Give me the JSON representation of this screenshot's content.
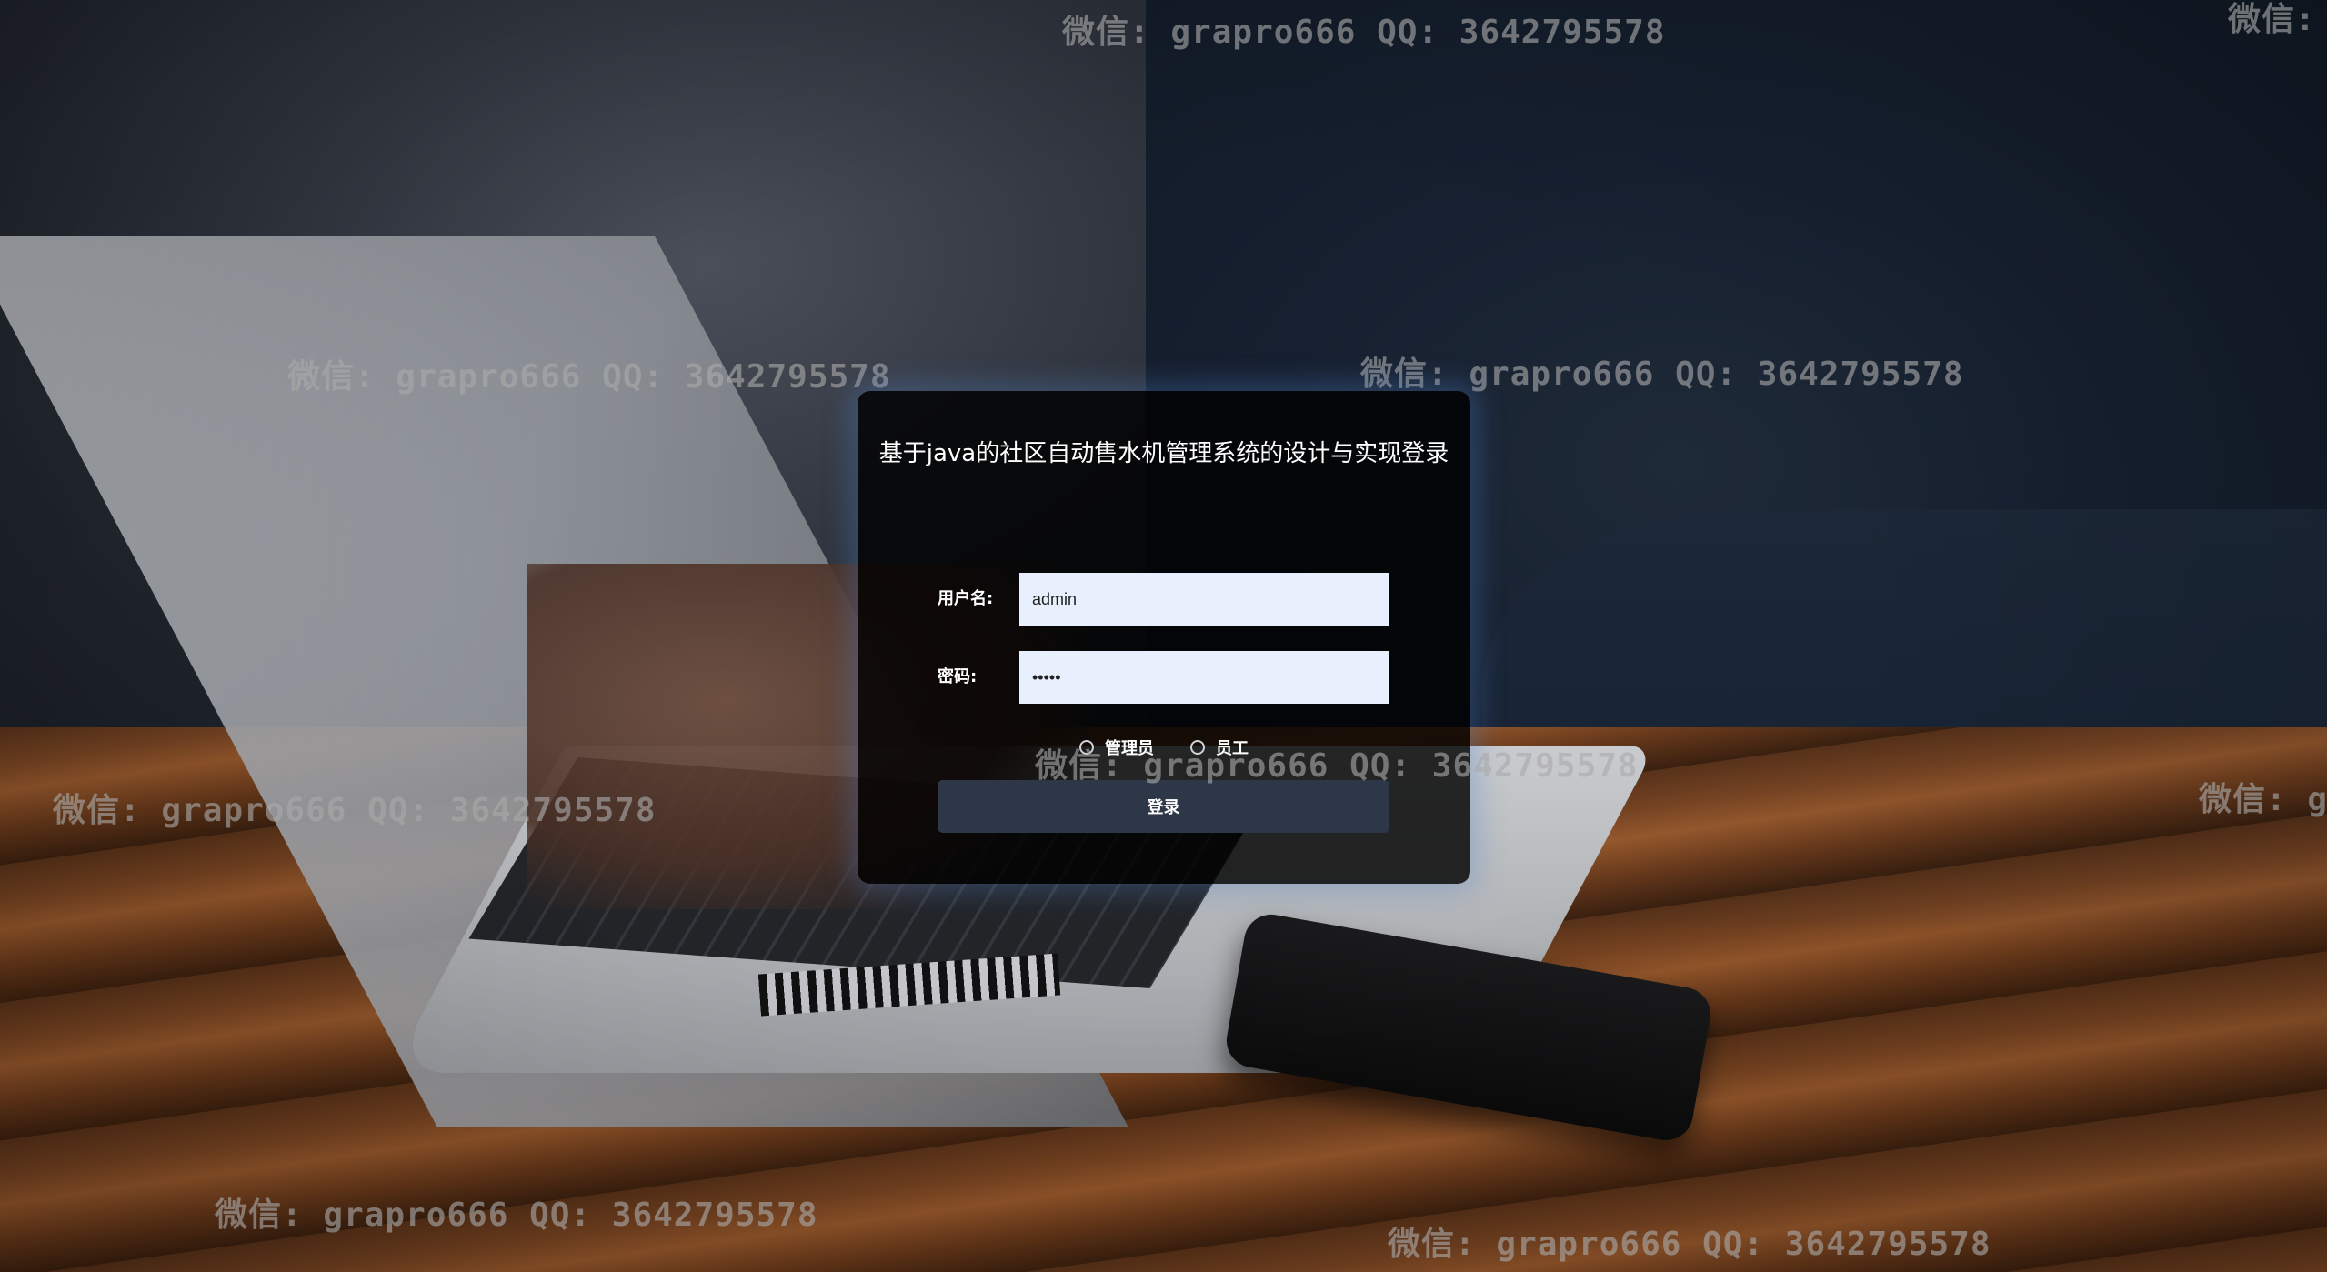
{
  "login": {
    "title": "基于java的社区自动售水机管理系统的设计与实现登录",
    "username_label": "用户名:",
    "username_value": "admin",
    "password_label": "密码:",
    "password_value": "•••••",
    "roles": [
      "管理员",
      "员工"
    ],
    "submit_label": "登录"
  },
  "watermark": {
    "text": "微信: grapro666 QQ: 3642795578",
    "text_top_right": "微信:",
    "text_right_mid": "微信: g"
  },
  "colors": {
    "card_background": "#000000",
    "input_background": "#e8f0fe",
    "button_background": "#2d3748",
    "card_glow": "#5082c8"
  }
}
